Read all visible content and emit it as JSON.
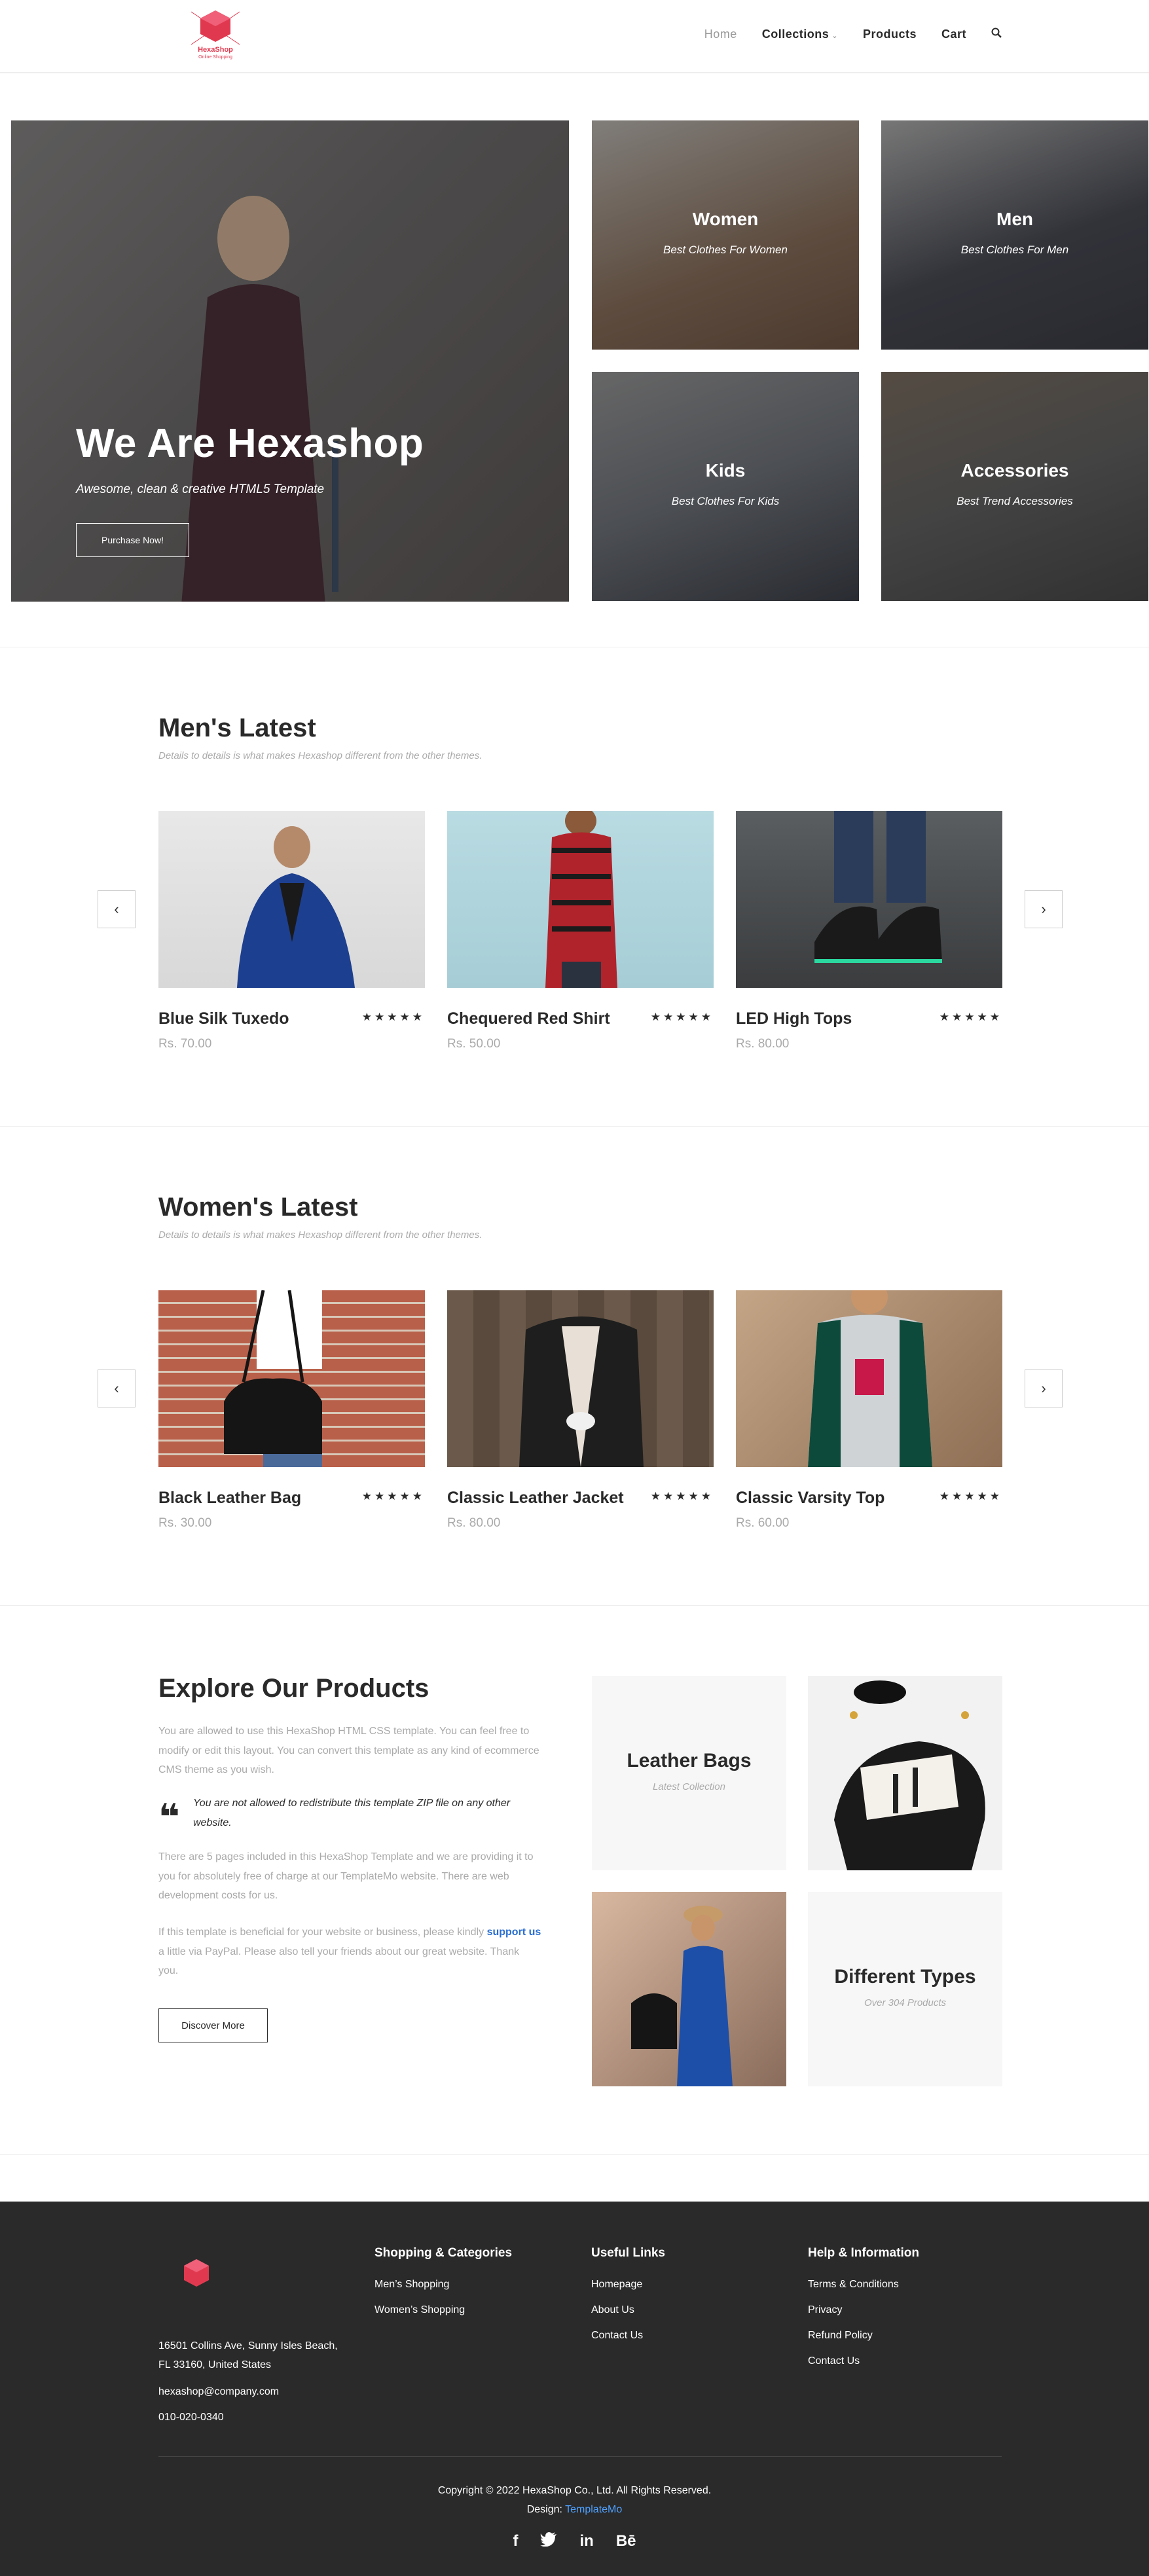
{
  "header": {
    "logo_text": "HexaShop",
    "logo_sub": "Online Shopping",
    "nav": {
      "home": "Home",
      "collections": "Collections",
      "products": "Products",
      "cart": "Cart"
    }
  },
  "hero": {
    "title": "We Are Hexashop",
    "subtitle": "Awesome, clean & creative HTML5 Template",
    "button": "Purchase Now!"
  },
  "categories": [
    {
      "title": "Women",
      "subtitle": "Best Clothes For Women"
    },
    {
      "title": "Men",
      "subtitle": "Best Clothes For Men"
    },
    {
      "title": "Kids",
      "subtitle": "Best Clothes For Kids"
    },
    {
      "title": "Accessories",
      "subtitle": "Best Trend Accessories"
    }
  ],
  "mens": {
    "title": "Men's Latest",
    "subtitle": "Details to details is what makes Hexashop different from the other themes.",
    "products": [
      {
        "name": "Blue Silk Tuxedo",
        "price": "Rs. 70.00",
        "rating": 5
      },
      {
        "name": "Chequered Red Shirt",
        "price": "Rs. 50.00",
        "rating": 5
      },
      {
        "name": "LED High Tops",
        "price": "Rs. 80.00",
        "rating": 5
      }
    ]
  },
  "womens": {
    "title": "Women's Latest",
    "subtitle": "Details to details is what makes Hexashop different from the other themes.",
    "products": [
      {
        "name": "Black Leather Bag",
        "price": "Rs. 30.00",
        "rating": 5
      },
      {
        "name": "Classic Leather Jacket",
        "price": "Rs. 80.00",
        "rating": 5
      },
      {
        "name": "Classic Varsity Top",
        "price": "Rs. 60.00",
        "rating": 5
      }
    ]
  },
  "stars": "★★★★★",
  "arrows": {
    "prev": "‹",
    "next": "›"
  },
  "explore": {
    "title": "Explore Our Products",
    "para1": "You are allowed to use this HexaShop HTML CSS template. You can feel free to modify or edit this layout. You can convert this template as any kind of ecommerce CMS theme as you wish.",
    "quote": "You are not allowed to redistribute this template ZIP file on any other website.",
    "para2": "There are 5 pages included in this HexaShop Template and we are providing it to you for absolutely free of charge at our TemplateMo website. There are web development costs for us.",
    "para3_a": "If this template is beneficial for your website or business, please kindly ",
    "para3_link": "support us",
    "para3_b": " a little via PayPal. Please also tell your friends about our great website. Thank you.",
    "button": "Discover More",
    "tiles": [
      {
        "title": "Leather Bags",
        "subtitle": "Latest Collection"
      },
      {
        "title": "Different Types",
        "subtitle": "Over 304 Products"
      }
    ]
  },
  "footer": {
    "address_line1": "16501 Collins Ave, Sunny Isles Beach,",
    "address_line2": "FL 33160, United States",
    "email": "hexashop@company.com",
    "phone": "010-020-0340",
    "columns": [
      {
        "title": "Shopping & Categories",
        "items": [
          "Men’s Shopping",
          "Women’s Shopping"
        ]
      },
      {
        "title": "Useful Links",
        "items": [
          "Homepage",
          "About Us",
          "Contact Us"
        ]
      },
      {
        "title": "Help & Information",
        "items": [
          "Terms & Conditions",
          "Privacy",
          "Refund Policy",
          "Contact Us"
        ]
      }
    ],
    "copyright": "Copyright © 2022 HexaShop Co., Ltd. All Rights Reserved.",
    "design_label": "Design: ",
    "design_link": "TemplateMo",
    "social": [
      "f",
      "t",
      "in",
      "Bē"
    ]
  },
  "colors": {
    "accent": "#e0394f",
    "dark": "#2a2a2a",
    "muted": "#aaaaaa",
    "link": "#4ea0ff"
  }
}
